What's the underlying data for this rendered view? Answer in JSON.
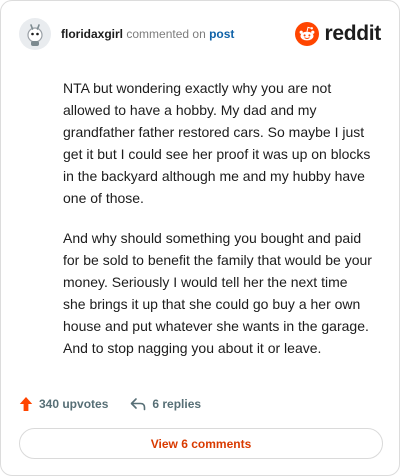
{
  "header": {
    "username": "floridaxgirl",
    "verb": "commented on",
    "post_link": "post",
    "brand": "reddit"
  },
  "comment": {
    "paragraphs": [
      "NTA but wondering exactly why you are not allowed to have a hobby. My dad and my grandfather father restored cars. So maybe I just get it but I could see her proof it was up on blocks in the backyard although me and my hubby have one of those.",
      "And why should something you bought and paid for be sold to benefit the family that would be your money. Seriously I would tell her the next time she brings it up that she could go buy a her own house and put whatever she wants in the garage. And to stop nagging you about it or leave."
    ]
  },
  "actions": {
    "upvotes": "340 upvotes",
    "replies": "6 replies"
  },
  "footer": {
    "view_comments": "View 6 comments"
  },
  "colors": {
    "brand_orange": "#ff4500",
    "link_blue": "#0f62a8",
    "button_text": "#d93a00"
  },
  "icons": [
    "avatar-icon",
    "reddit-logo-icon",
    "upvote-arrow-icon",
    "reply-arrow-icon"
  ]
}
